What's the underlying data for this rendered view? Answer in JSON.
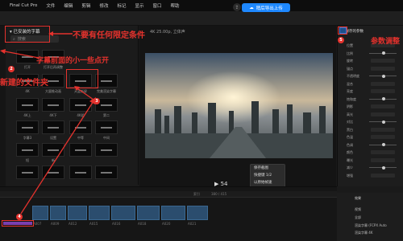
{
  "menubar": {
    "apple": "",
    "items": [
      "Final Cut Pro",
      "文件",
      "编辑",
      "剪辑",
      "修改",
      "标记",
      "显示",
      "窗口",
      "帮助"
    ]
  },
  "toolbar": {
    "export_label": "稍后导出上传"
  },
  "media": {
    "tab_label": "已安装的字幕",
    "search_placeholder": "搜索",
    "thumb_labels": [
      "打开",
      "打开后再调整",
      "4K",
      "大量推动画",
      "天蓝新屏",
      "完美渲染字幕",
      "4K上",
      "4K下",
      "4K组",
      "第二",
      "字幕3",
      "设置",
      "中等",
      "中间",
      "短",
      "新"
    ]
  },
  "preview": {
    "meta": "4K 25.00p, 立体声",
    "context_menu": [
      "保存截图",
      "快捷键  1/2",
      "以原始帧速"
    ],
    "timecode": "▶ 54"
  },
  "inspector": {
    "title": "已保存的参数",
    "rows": [
      "位置",
      "比例",
      "旋转",
      "锚点",
      "不透明度",
      "混合",
      "亮度",
      "饱和度",
      "阴影",
      "高光",
      "对比",
      "黑白",
      "色温",
      "色调",
      "颜色",
      "曝光",
      "减少",
      "增强"
    ]
  },
  "timeline": {
    "index_label": "索引",
    "duration": "380 / 415",
    "clip_labels": [
      "A007",
      "A009",
      "A012",
      "A015",
      "A016",
      "A018",
      "A020",
      "A021"
    ]
  },
  "effects": {
    "header": "效果",
    "items": [
      "视频",
      "全部",
      "渲染字幕 (FCPX Auto",
      "渲染字幕 4K"
    ]
  },
  "annotations": {
    "no_condition": "不要有任何限定条件",
    "dot_above": "字幕前面的小一些点开",
    "new_folder": "新建的文件夹",
    "adjust_params": "参数调整",
    "badge_1": "1",
    "badge_2": "2",
    "badge_3": "3",
    "badge_4": "4",
    "badge_5": "5"
  },
  "colors": {
    "annotation_red": "#e5322d",
    "export_blue": "#1e88ff"
  }
}
